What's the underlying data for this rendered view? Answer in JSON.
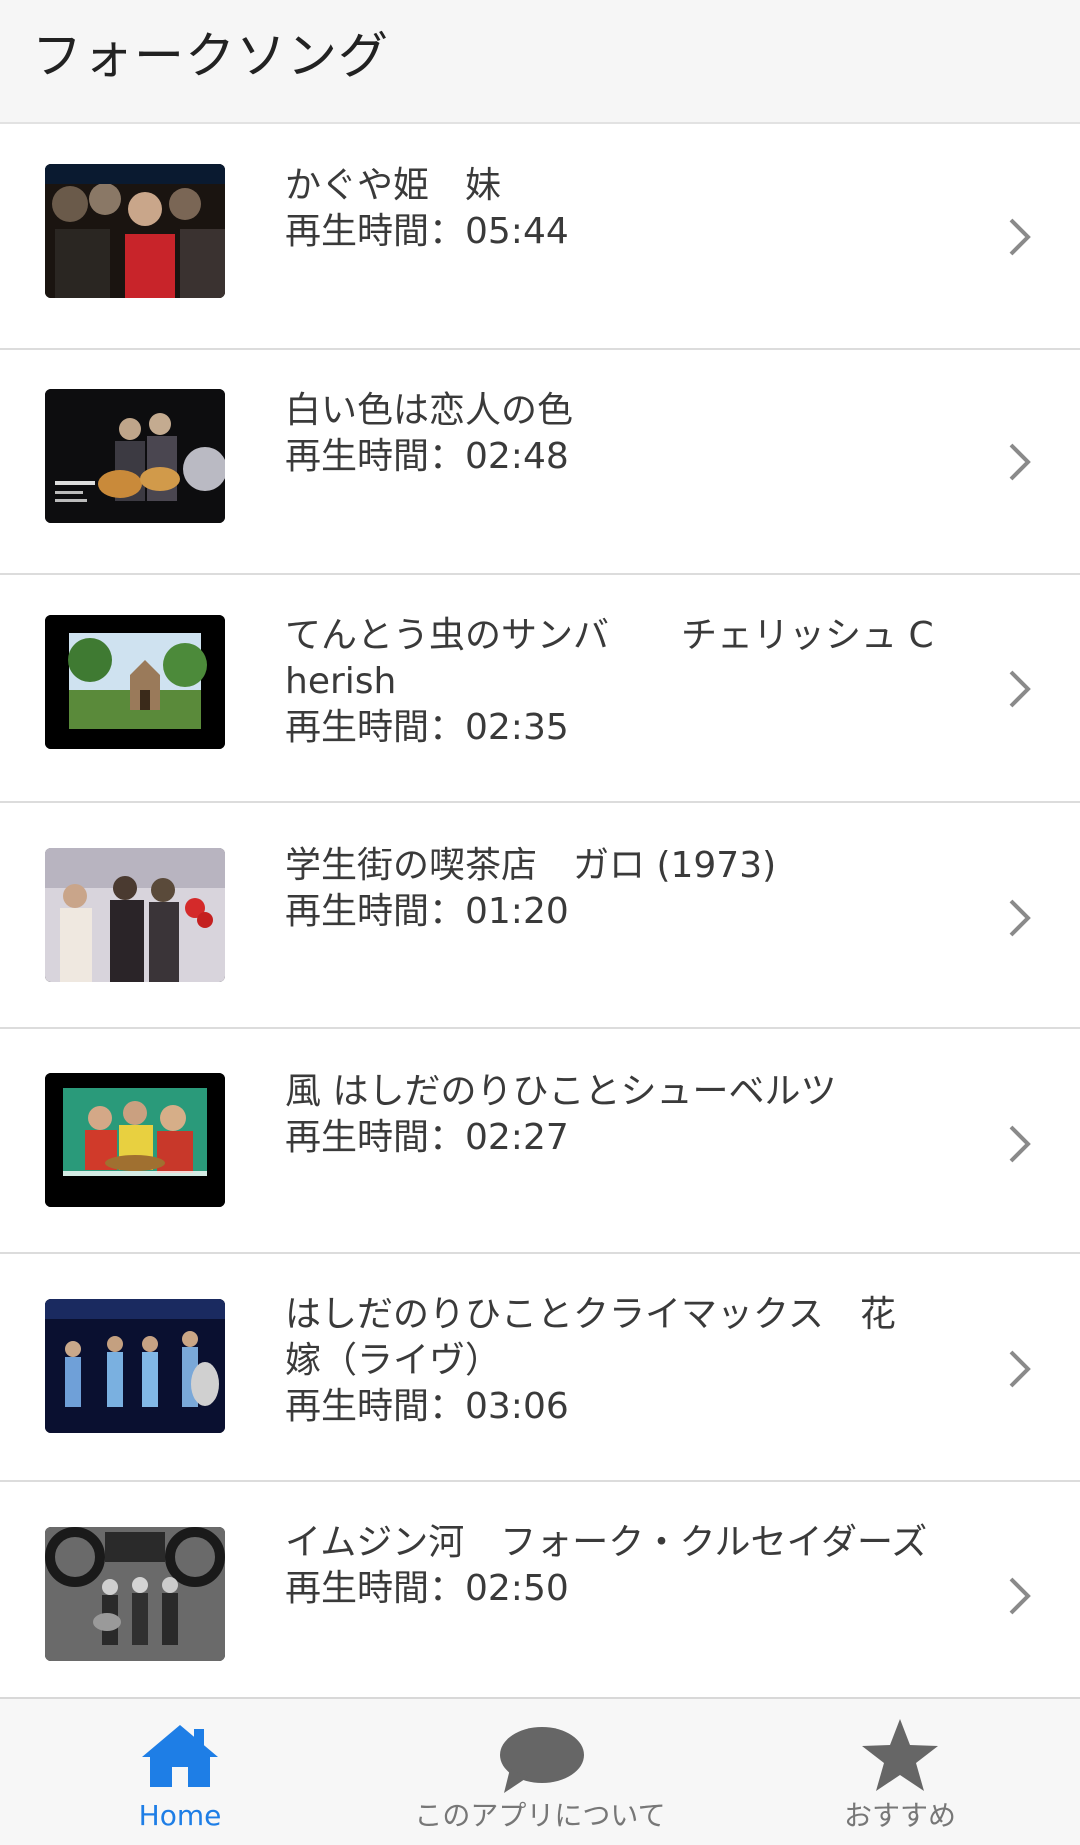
{
  "header": {
    "title": "フォークソング"
  },
  "videos": [
    {
      "title": "かぐや姫　妹",
      "duration": "再生時間：05:44"
    },
    {
      "title": "白い色は恋人の色",
      "duration": "再生時間：02:48"
    },
    {
      "title": "てんとう虫のサンバ　　チェリッシュ Cherish",
      "duration": "再生時間：02:35"
    },
    {
      "title": "学生街の喫茶店　ガロ (1973)",
      "duration": "再生時間：01:20"
    },
    {
      "title": "風 はしだのりひことシューベルツ",
      "duration": "再生時間：02:27"
    },
    {
      "title": "はしだのりひことクライマックス　花嫁（ライヴ）",
      "duration": "再生時間：03:06"
    },
    {
      "title": "イムジン河　フォーク・クルセイダーズ",
      "duration": "再生時間：02:50"
    }
  ],
  "tabbar": {
    "tabs": [
      {
        "label": "Home",
        "icon": "home-icon",
        "active": true
      },
      {
        "label": "このアプリについて",
        "icon": "speech-bubble-icon",
        "active": false
      },
      {
        "label": "おすすめ",
        "icon": "star-icon",
        "active": false
      }
    ]
  },
  "colors": {
    "accent": "#1e7ee6",
    "inactive": "#666666",
    "header_bg": "#f6f6f6",
    "text": "#3a3a3a"
  }
}
